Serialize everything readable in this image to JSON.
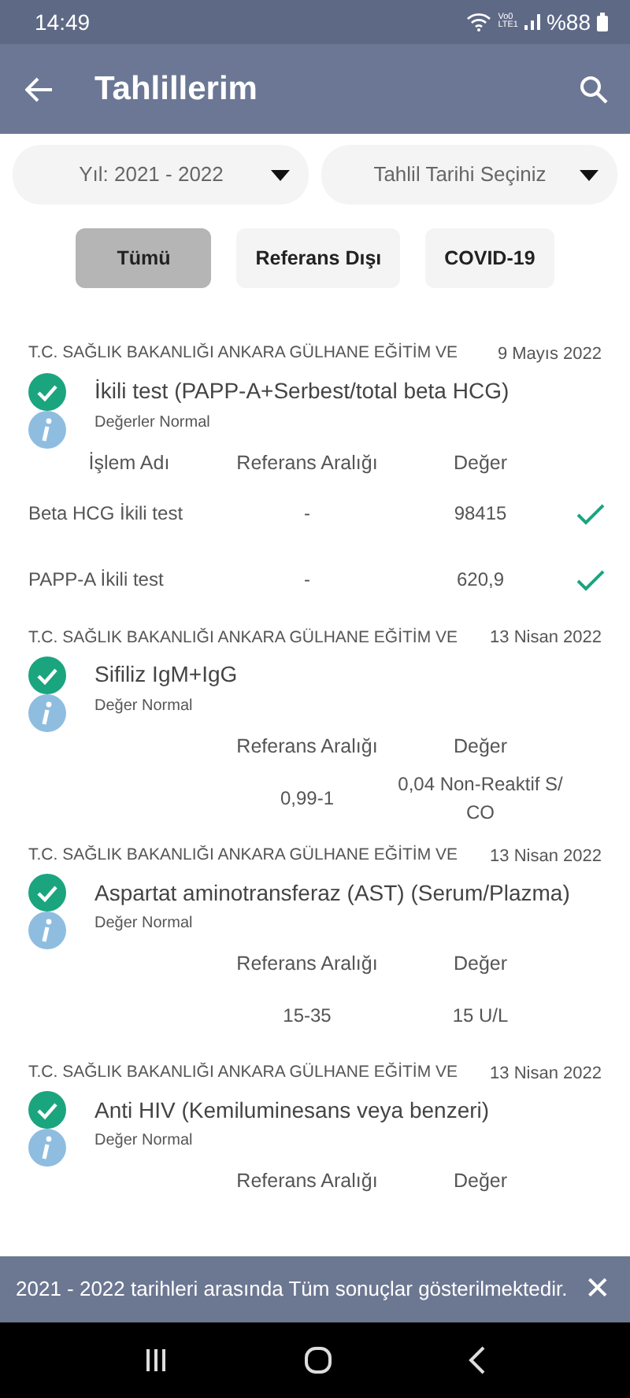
{
  "status_bar": {
    "time": "14:49",
    "network_label": [
      "Vo0",
      "LTE1"
    ],
    "battery": "%88"
  },
  "app_bar": {
    "title": "Tahlillerim"
  },
  "filters": [
    {
      "label": "Yıl: 2021 - 2022"
    },
    {
      "label": "Tahlil Tarihi Seçiniz"
    }
  ],
  "chips": [
    {
      "label": "Tümü",
      "selected": true
    },
    {
      "label": "Referans Dışı",
      "selected": false
    },
    {
      "label": "COVID-19",
      "selected": false
    }
  ],
  "results": [
    {
      "institution": "T.C. SAĞLIK BAKANLIĞI ANKARA GÜLHANE EĞİTİM VE",
      "date": "9 Mayıs 2022",
      "title": "İkili test (PAPP-A+Serbest/total beta HCG)",
      "note": "Değerler Normal",
      "columns": {
        "name": "İşlem Adı",
        "reference": "Referans Aralığı",
        "value": "Değer"
      },
      "rows": [
        {
          "name": "Beta HCG İkili test",
          "reference": "-",
          "value": "98415",
          "checked": true
        },
        {
          "name": "PAPP-A İkili test",
          "reference": "-",
          "value": "620,9",
          "checked": true
        }
      ]
    },
    {
      "institution": "T.C. SAĞLIK BAKANLIĞI ANKARA GÜLHANE EĞİTİM VE",
      "date": "13 Nisan 2022",
      "title": "Sifiliz IgM+IgG",
      "note": "Değer Normal",
      "columns": {
        "reference": "Referans Aralığı",
        "value": "Değer"
      },
      "rows": [
        {
          "reference": "0,99-1",
          "value": "0,04 Non-Reaktif S/ CO",
          "checked": false
        }
      ]
    },
    {
      "institution": "T.C. SAĞLIK BAKANLIĞI ANKARA GÜLHANE EĞİTİM VE",
      "date": "13 Nisan 2022",
      "title": "Aspartat aminotransferaz (AST) (Serum/Plazma)",
      "note": "Değer Normal",
      "columns": {
        "reference": "Referans Aralığı",
        "value": "Değer"
      },
      "rows": [
        {
          "reference": "15-35",
          "value": "15 U/L",
          "checked": false
        }
      ]
    },
    {
      "institution": "T.C. SAĞLIK BAKANLIĞI ANKARA GÜLHANE EĞİTİM VE",
      "date": "13 Nisan 2022",
      "title": "Anti HIV (Kemiluminesans veya benzeri)",
      "note": "Değer Normal",
      "columns": {
        "reference": "Referans Aralığı",
        "value": "Değer"
      }
    }
  ],
  "snackbar": {
    "message": "2021 - 2022 tarihleri arasında Tüm sonuçlar gösterilmektedir.",
    "close": "✕"
  }
}
